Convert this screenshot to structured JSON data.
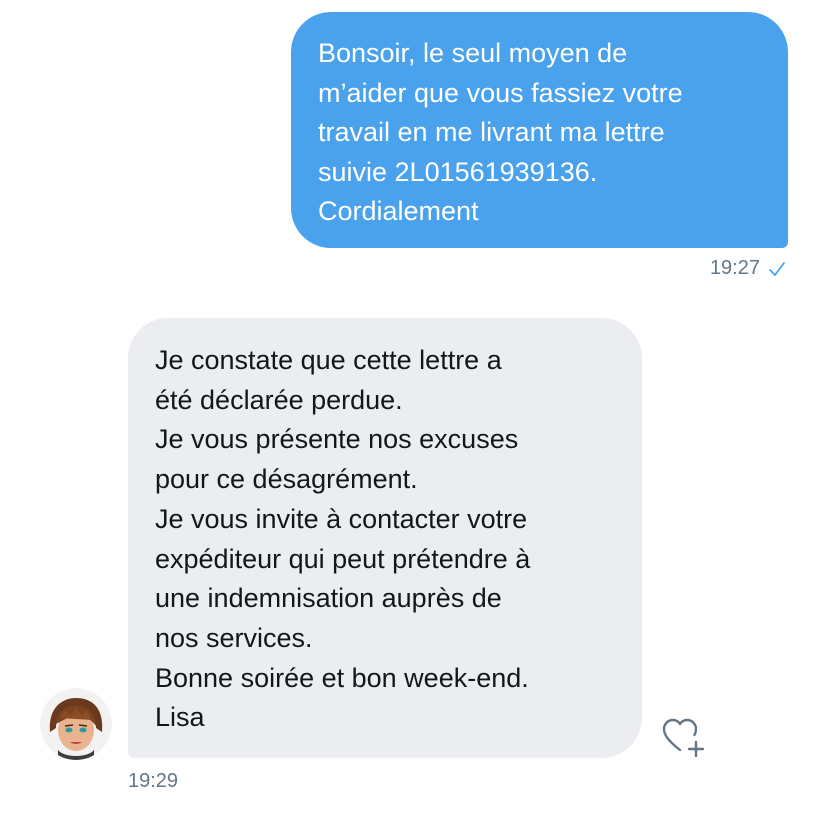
{
  "conversation": {
    "outgoing": {
      "text": "Bonsoir, le seul moyen de\nm’aider que vous fassiez votre\ntravail en me livrant ma lettre\nsuivie 2L01561939136.\nCordialement",
      "time": "19:27",
      "status_icon": "check-icon",
      "bubble_color": "#4aa1ec"
    },
    "incoming": {
      "text": "Je constate que cette lettre a\nété déclarée perdue.\nJe vous présente nos excuses\npour ce désagrément.\nJe vous invite à contacter votre\nexpéditeur qui peut prétendre à\nune indemnisation auprès de\nnos services.\nBonne soirée et bon week-end.\nLisa",
      "time": "19:29",
      "avatar_icon": "agent-avatar",
      "reaction_icon": "heart-plus-icon",
      "bubble_color": "#ebedf0"
    }
  }
}
